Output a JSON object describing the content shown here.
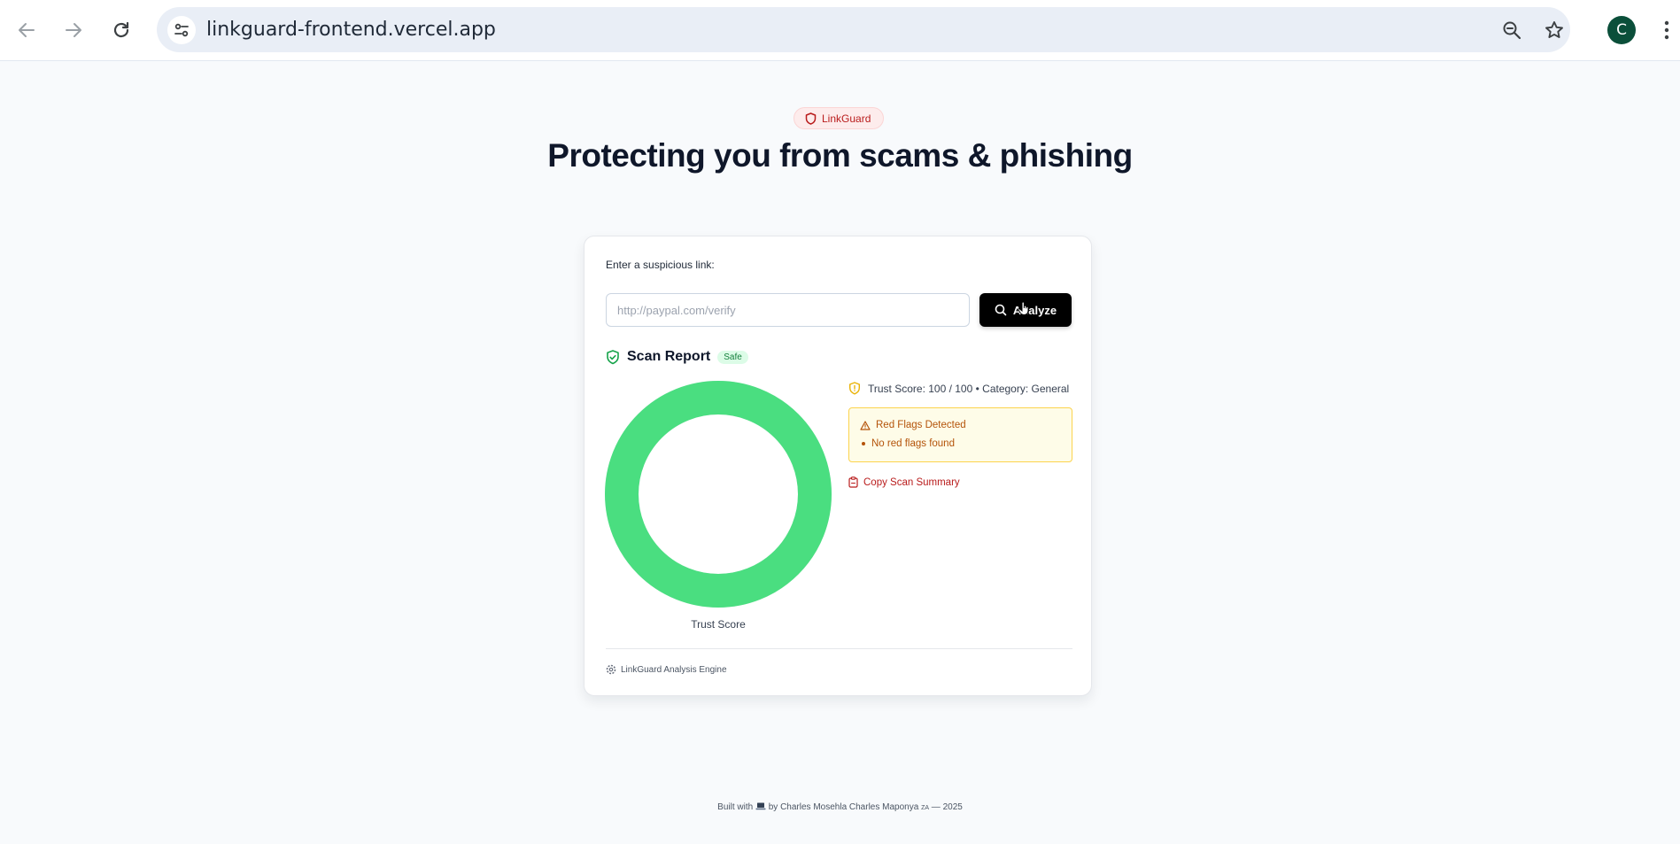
{
  "browser": {
    "url": "linkguard-frontend.vercel.app",
    "avatar_letter": "C",
    "icons": [
      "back-arrow-icon",
      "forward-arrow-icon",
      "reload-icon",
      "site-settings-icon",
      "zoom-out-icon",
      "bookmark-star-icon",
      "more-vert-icon"
    ]
  },
  "hero": {
    "brand": "LinkGuard",
    "title": "Protecting you from scams & phishing"
  },
  "form": {
    "label": "Enter a suspicious link:",
    "placeholder": "http://paypal.com/verify",
    "value": "",
    "analyze_label": "Analyze"
  },
  "report": {
    "title": "Scan Report",
    "status_badge": "Safe",
    "trust_score": 100,
    "trust_score_max": 100,
    "trust_line": "Trust Score: 100 / 100 • Category: General",
    "chart_caption": "Trust Score",
    "red_flags_title": "Red Flags Detected",
    "red_flags": [
      "No red flags found"
    ],
    "copy_label": "Copy Scan Summary",
    "engine_label": "LinkGuard Analysis Engine"
  },
  "footer": {
    "prefix": "Built with",
    "icon": "laptop-icon",
    "suffix": "by Charles Mosehla Charles Maponya",
    "country": "ZA",
    "year_text": "— 2025"
  },
  "colors": {
    "accent": "#000000",
    "brand_red": "#b91c1c",
    "safe_green": "#4ade80",
    "warning_amber": "#b45309",
    "warning_bg": "#fefce8",
    "page_bg": "#f8fafc"
  }
}
